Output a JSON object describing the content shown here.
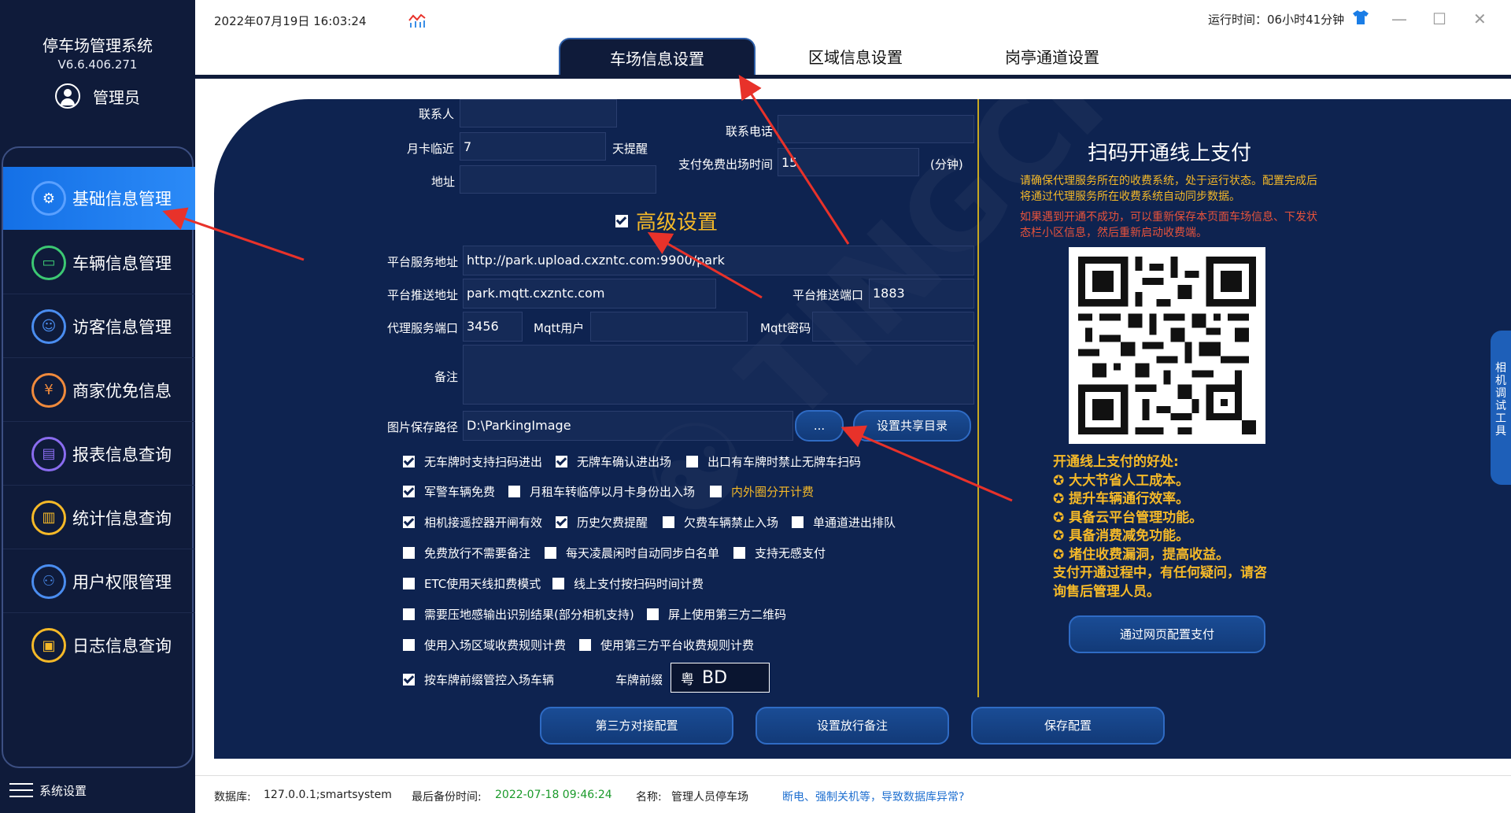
{
  "app": {
    "title": "停车场管理系统",
    "version": "V6.6.406.271",
    "user": "管理员"
  },
  "topbar": {
    "datetime": "2022年07月19日 16:03:24",
    "runtime": "运行时间：06小时41分钟"
  },
  "tabs": [
    {
      "label": "车场信息设置",
      "active": true
    },
    {
      "label": "区域信息设置",
      "active": false
    },
    {
      "label": "岗亭通道设置",
      "active": false
    }
  ],
  "nav": {
    "items": [
      {
        "label": "基础信息管理",
        "icon": "gear-icon",
        "color": "#5aa0ff"
      },
      {
        "label": "车辆信息管理",
        "icon": "car-icon",
        "color": "#3cc873"
      },
      {
        "label": "访客信息管理",
        "icon": "visitor-icon",
        "color": "#4a8df0"
      },
      {
        "label": "商家优免信息",
        "icon": "coupon-icon",
        "color": "#f08a3c"
      },
      {
        "label": "报表信息查询",
        "icon": "report-icon",
        "color": "#8a6cf0"
      },
      {
        "label": "统计信息查询",
        "icon": "stats-icon",
        "color": "#f5b928"
      },
      {
        "label": "用户权限管理",
        "icon": "users-icon",
        "color": "#4a8df0"
      },
      {
        "label": "日志信息查询",
        "icon": "log-icon",
        "color": "#f5b928"
      }
    ],
    "settings_label": "系统设置"
  },
  "form": {
    "contact_label": "联系人",
    "contact_value": "",
    "phone_label": "联系电话",
    "phone_value": "",
    "monthly_remind_label": "月卡临近",
    "monthly_remind_value": "7",
    "monthly_remind_unit": "天提醒",
    "free_exit_label": "支付免费出场时间",
    "free_exit_value": "15",
    "free_exit_unit": "(分钟)",
    "address_label": "地址",
    "address_value": "",
    "advanced_label": "高级设置",
    "platform_url_label": "平台服务地址",
    "platform_url_value": "http://park.upload.cxzntc.com:9900/park",
    "push_addr_label": "平台推送地址",
    "push_addr_value": "park.mqtt.cxzntc.com",
    "push_port_label": "平台推送端口",
    "push_port_value": "1883",
    "proxy_port_label": "代理服务端口",
    "proxy_port_value": "3456",
    "mqtt_user_label": "Mqtt用户",
    "mqtt_user_value": "",
    "mqtt_pass_label": "Mqtt密码",
    "mqtt_pass_value": "",
    "remark_label": "备注",
    "remark_value": "",
    "image_path_label": "图片保存路径",
    "image_path_value": "D:\\ParkingImage",
    "browse_label": "...",
    "share_dir_label": "设置共享目录",
    "plate_prefix_label": "车牌前缀",
    "plate_province": "粤",
    "plate_letters": "BD"
  },
  "checkboxes": {
    "row1": [
      {
        "label": "无车牌时支持扫码进出",
        "checked": true
      },
      {
        "label": "无牌车确认进出场",
        "checked": true
      },
      {
        "label": "出口有车牌时禁止无牌车扫码",
        "checked": false
      }
    ],
    "row2": [
      {
        "label": "军警车辆免费",
        "checked": true
      },
      {
        "label": "月租车转临停以月卡身份出入场",
        "checked": false
      },
      {
        "label": "内外圈分开计费",
        "checked": false
      }
    ],
    "row3": [
      {
        "label": "相机接遥控器开闸有效",
        "checked": true
      },
      {
        "label": "历史欠费提醒",
        "checked": true
      },
      {
        "label": "欠费车辆禁止入场",
        "checked": false
      },
      {
        "label": "单通道进出排队",
        "checked": false
      }
    ],
    "row4": [
      {
        "label": "免费放行不需要备注",
        "checked": false
      },
      {
        "label": "每天凌晨闲时自动同步白名单",
        "checked": false
      },
      {
        "label": "支持无感支付",
        "checked": false
      }
    ],
    "row5": [
      {
        "label": "ETC使用天线扣费模式",
        "checked": false
      },
      {
        "label": "线上支付按扫码时间计费",
        "checked": false
      }
    ],
    "row6": [
      {
        "label": "需要压地感输出识别结果(部分相机支持)",
        "checked": false
      },
      {
        "label": "屏上使用第三方二维码",
        "checked": false
      }
    ],
    "row7": [
      {
        "label": "使用入场区域收费规则计费",
        "checked": false
      },
      {
        "label": "使用第三方平台收费规则计费",
        "checked": false
      }
    ],
    "row8": [
      {
        "label": "按车牌前缀管控入场车辆",
        "checked": true
      }
    ]
  },
  "buttons": {
    "third_party": "第三方对接配置",
    "release_remark": "设置放行备注",
    "save": "保存配置",
    "web_config": "通过网页配置支付"
  },
  "payment": {
    "title": "扫码开通线上支付",
    "note1": "请确保代理服务所在的收费系统，处于运行状态。配置完成后将通过代理服务所在收费系统自动同步数据。",
    "note2": "如果遇到开通不成功，可以重新保存本页面车场信息、下发状态栏小区信息，然后重新启动收费端。",
    "benefits_title": "开通线上支付的好处:",
    "benefits": [
      "✪ 大大节省人工成本。",
      "✪ 提升车辆通行效率。",
      "✪ 具备云平台管理功能。",
      "✪ 具备消费减免功能。",
      "✪ 堵住收费漏洞，提高收益。"
    ],
    "benefits_footer1": "支付开通过程中，有任何疑问，请咨",
    "benefits_footer2": "询售后管理人员。"
  },
  "sidetab": {
    "label": "相机调试工具"
  },
  "status": {
    "db_label": "数据库:",
    "db_value": "127.0.0.1;smartsystem",
    "backup_label": "最后备份时间:",
    "backup_value": "2022-07-18 09:46:24",
    "name_label": "名称:",
    "name_value": "管理人员停车场",
    "warning": "断电、强制关机等，导致数据库异常?"
  },
  "colors": {
    "sidebar_bg": "#0f1b3a",
    "panel_bg": "#0e2350",
    "accent_blue": "#1470e6",
    "gold": "#f5b928",
    "warn_red": "#e8533b",
    "arrow_red": "#e8322a",
    "backup_green": "#1a9a2a"
  }
}
